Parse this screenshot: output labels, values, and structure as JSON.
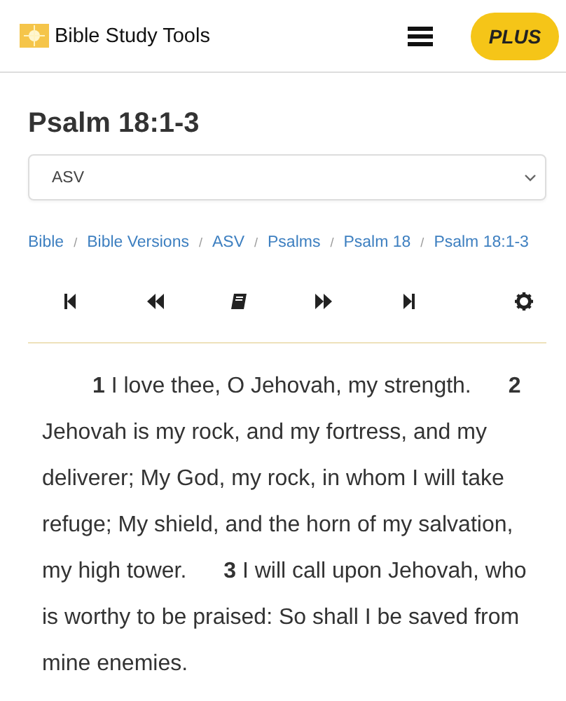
{
  "header": {
    "site_name": "Bible Study Tools",
    "plus_button": "PLUS"
  },
  "title": "Psalm 18:1-3",
  "version_select": {
    "value": "ASV"
  },
  "breadcrumbs": [
    "Bible",
    "Bible Versions",
    "ASV",
    "Psalms",
    "Psalm 18",
    "Psalm 18:1-3"
  ],
  "breadcrumb_separator": "/",
  "passage": "**1** I love thee, O Jehovah, my strength. **2** Jehovah is my rock, and my fortress, and my deliverer; My God, my rock, in whom I will take refuge; My shield, and the horn of my salvation, my high tower. **3** I will call upon Jehovah, who is worthy to be praised: So shall I be saved from mine enemies."
}
